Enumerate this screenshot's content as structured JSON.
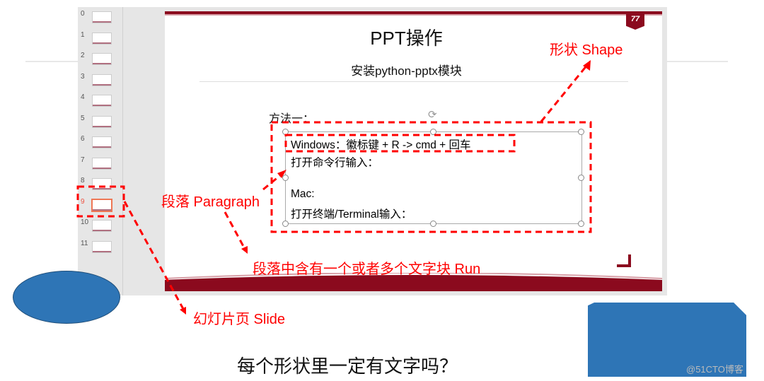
{
  "sidebar": {
    "slides": [
      "0",
      "1",
      "2",
      "3",
      "4",
      "5",
      "6",
      "7",
      "8",
      "9",
      "10",
      "11"
    ],
    "active_index": 9
  },
  "slide": {
    "title": "PPT操作",
    "subtitle": "安装python-pptx模块",
    "method_label": "方法一：",
    "textbox_lines": [
      "Windows：徽标键 + R   ->  cmd + 回车",
      "打开命令行输入：",
      "",
      "Mac:",
      "打开终端/Terminal输入："
    ],
    "logo_text": "77"
  },
  "annotations": {
    "shape": "形状 Shape",
    "paragraph": "段落 Paragraph",
    "run": "段落中含有一个或者多个文字块 Run",
    "slide": "幻灯片页 Slide"
  },
  "question": "每个形状里一定有文字吗？",
  "watermark": "@51CTO博客",
  "colors": {
    "annotation": "#ff0000",
    "accent": "#8b0a1e",
    "shape_fill": "#2e75b6"
  }
}
